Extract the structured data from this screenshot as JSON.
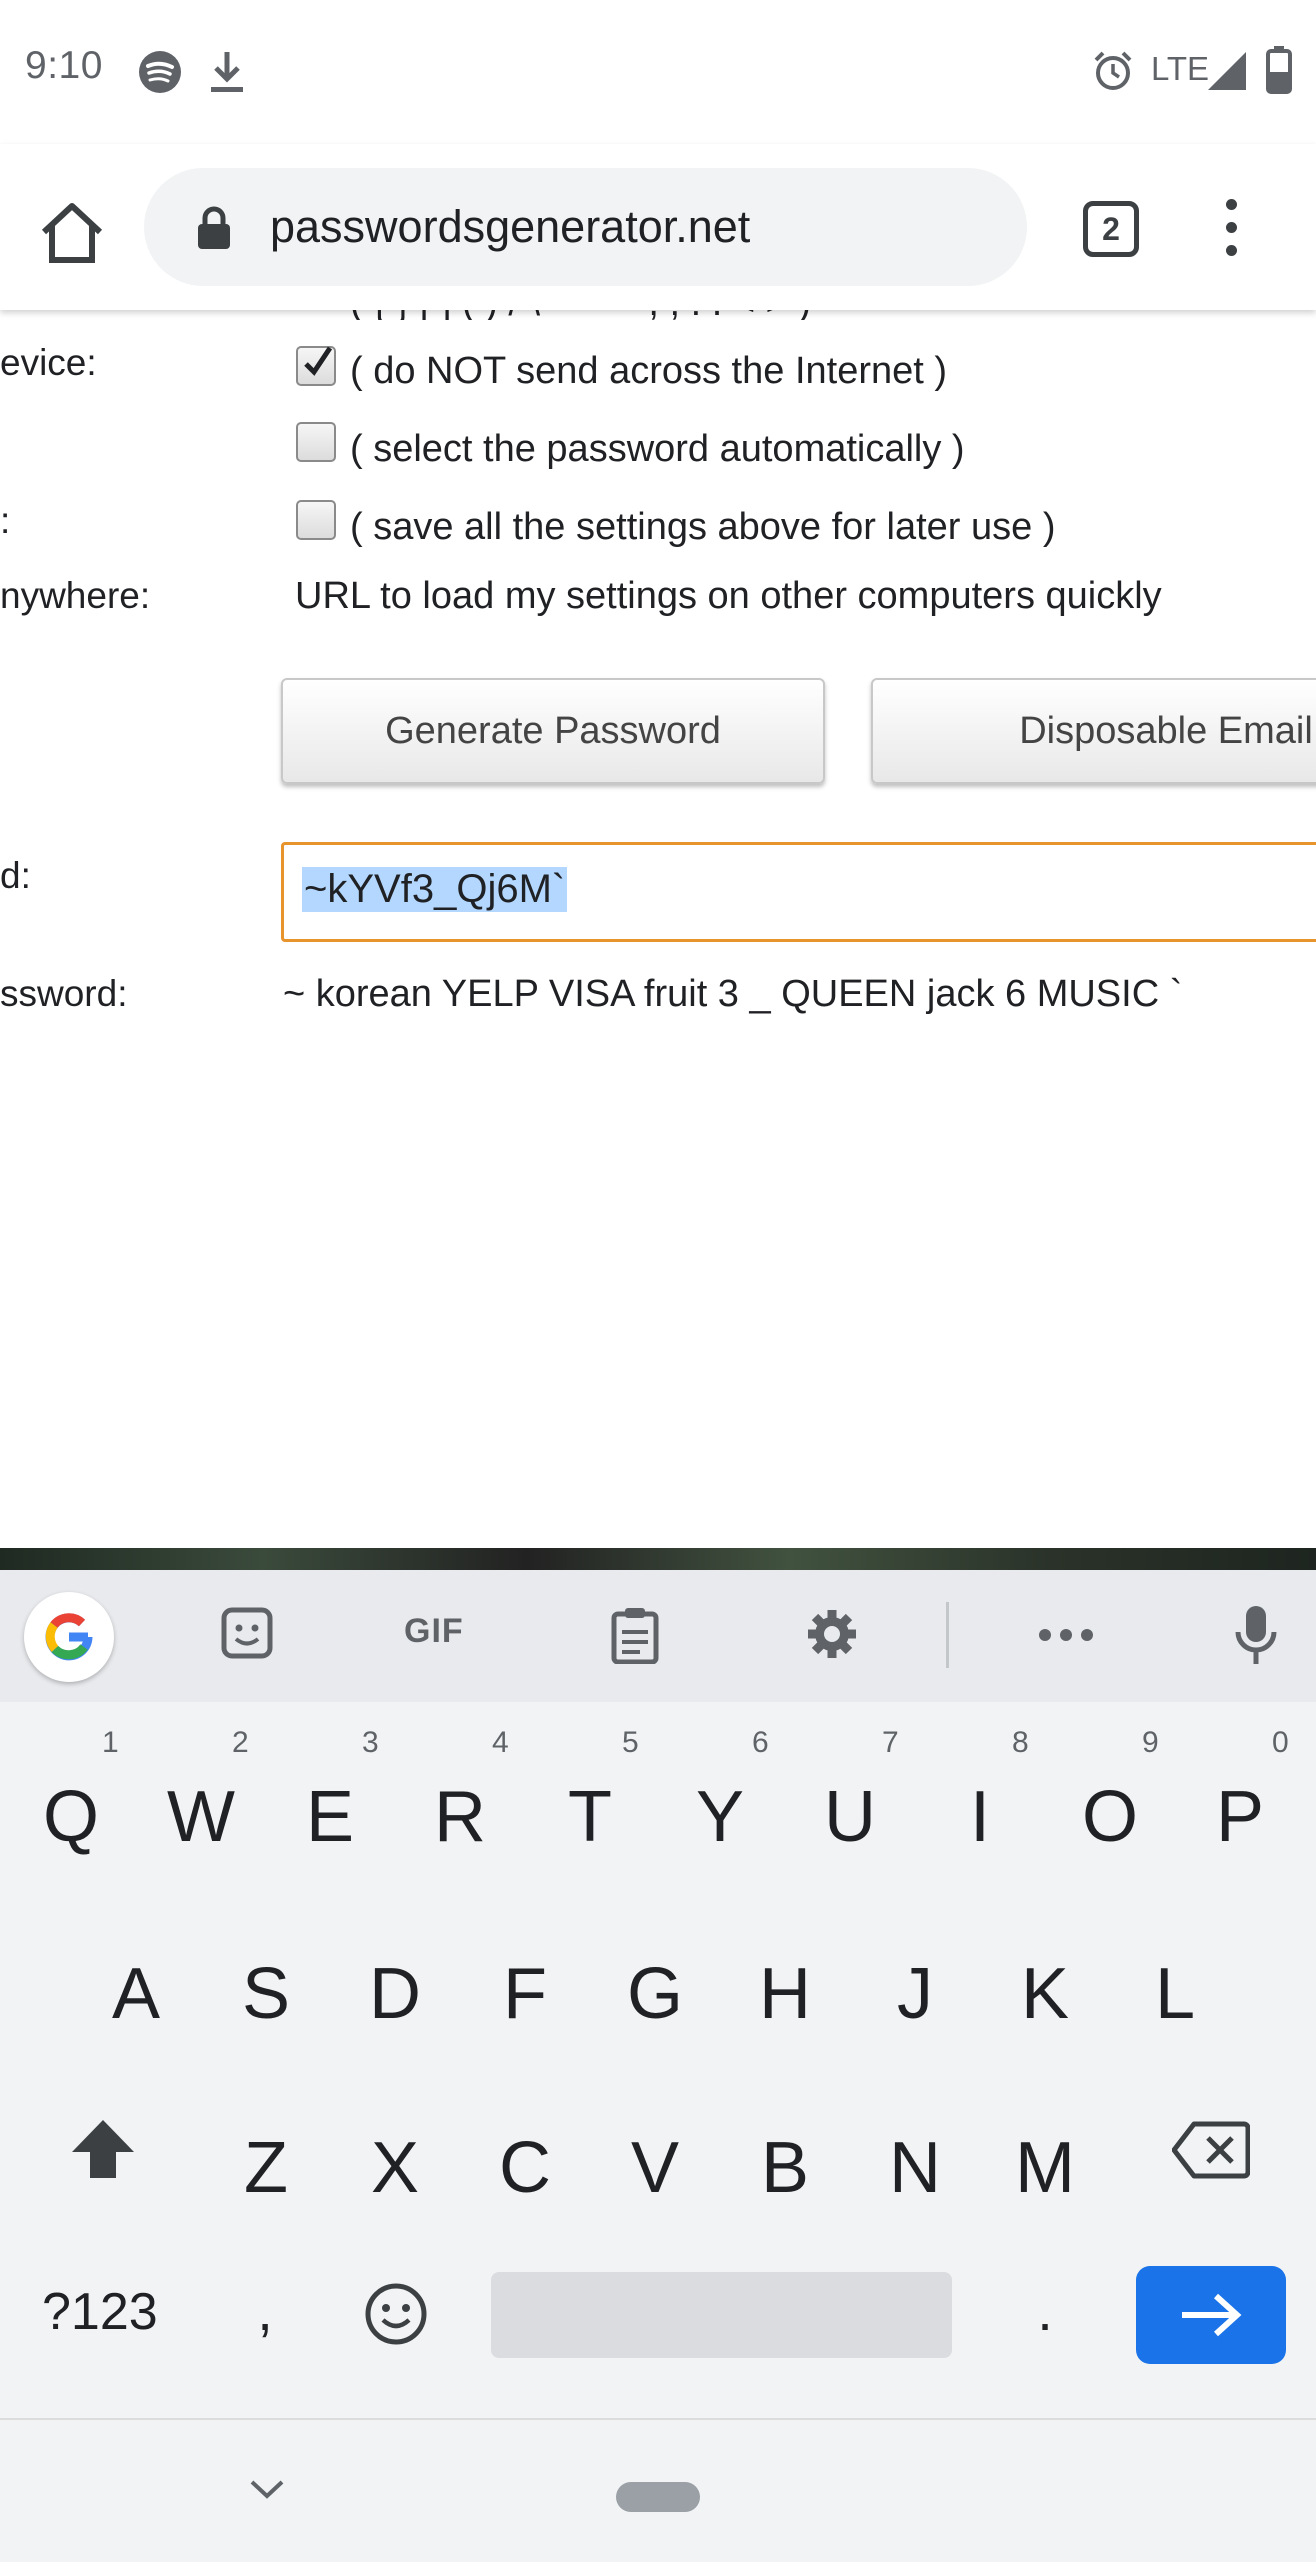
{
  "status_bar": {
    "time": "9:10",
    "network": "LTE",
    "icons": [
      "spotify-icon",
      "download-icon",
      "alarm-icon",
      "signal-icon",
      "battery-icon"
    ]
  },
  "browser": {
    "url": "passwordsgenerator.net",
    "tab_count": "2"
  },
  "page": {
    "clipped_row": "( { } [ ] ( ) / \\ ' \" ` ~ , ; : . < > )",
    "rows": [
      {
        "label": "evice:",
        "checked": true,
        "text": "( do NOT send across the Internet )"
      },
      {
        "label": "",
        "checked": false,
        "text": "( select the password automatically )"
      },
      {
        "label": ":",
        "checked": false,
        "text": "( save all the settings above for later use )"
      }
    ],
    "anywhere_label": "nywhere:",
    "anywhere_text": "URL to load my settings on other computers quickly",
    "generate_button": "Generate Password",
    "disposable_button": "Disposable Email",
    "password_label": "d:",
    "password_value": "~kYVf3_Qj6M`",
    "remember_label": "ssword:",
    "phonetic": "~ korean YELP VISA fruit 3 _ QUEEN jack 6 MUSIC `"
  },
  "keyboard": {
    "toolbar": [
      "google-icon",
      "sticker-icon",
      "GIF",
      "clipboard-icon",
      "settings-icon",
      "more-icon",
      "mic-icon"
    ],
    "gif_label": "GIF",
    "row1": [
      "Q",
      "W",
      "E",
      "R",
      "T",
      "Y",
      "U",
      "I",
      "O",
      "P"
    ],
    "row1_hints": [
      "1",
      "2",
      "3",
      "4",
      "5",
      "6",
      "7",
      "8",
      "9",
      "0"
    ],
    "row2": [
      "A",
      "S",
      "D",
      "F",
      "G",
      "H",
      "J",
      "K",
      "L"
    ],
    "row3": [
      "Z",
      "X",
      "C",
      "V",
      "B",
      "N",
      "M"
    ],
    "symbols_key": "?123",
    "comma": ",",
    "period": ".",
    "accent_color": "#1a73e8"
  }
}
